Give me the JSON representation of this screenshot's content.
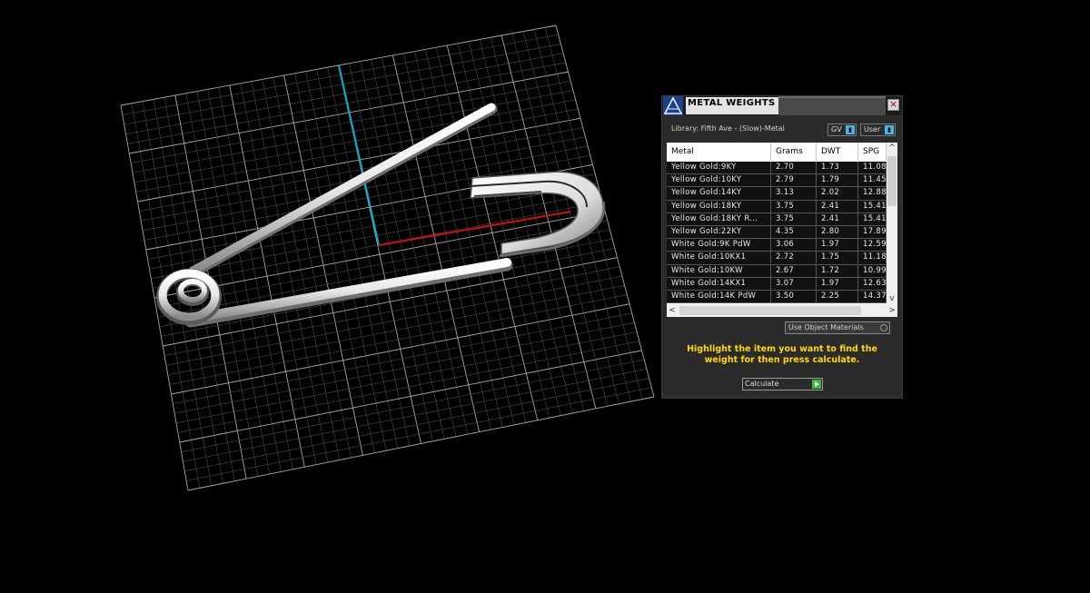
{
  "panel": {
    "title": "METAL WEIGHTS",
    "close_glyph": "×",
    "library_label": "Library: Fifth Ave - (Slow)-Metal",
    "mode_buttons": [
      {
        "label": "GV",
        "icon": "toggle-arrow-icon"
      },
      {
        "label": "User",
        "icon": "toggle-arrow-icon"
      }
    ],
    "table": {
      "columns": [
        "Metal",
        "Grams",
        "DWT",
        "SPG"
      ],
      "rows": [
        [
          "Yellow Gold:9KY",
          "2.70",
          "1.73",
          "11.08"
        ],
        [
          "Yellow Gold:10KY",
          "2.79",
          "1.79",
          "11.45"
        ],
        [
          "Yellow Gold:14KY",
          "3.13",
          "2.02",
          "12.88"
        ],
        [
          "Yellow Gold:18KY",
          "3.75",
          "2.41",
          "15.41"
        ],
        [
          "Yellow Gold:18KY R...",
          "3.75",
          "2.41",
          "15.41"
        ],
        [
          "Yellow Gold:22KY",
          "4.35",
          "2.80",
          "17.89"
        ],
        [
          "White Gold:9K PdW",
          "3.06",
          "1.97",
          "12.59"
        ],
        [
          "White Gold:10KX1",
          "2.72",
          "1.75",
          "11.18"
        ],
        [
          "White Gold:10KW",
          "2.67",
          "1.72",
          "10.99"
        ],
        [
          "White Gold:14KX1",
          "3.07",
          "1.97",
          "12.63"
        ],
        [
          "White Gold:14K PdW",
          "3.50",
          "2.25",
          "14.37"
        ]
      ]
    },
    "use_object_materials_label": "Use Object Materials",
    "instruction": "Highlight the item you want to find the weight for then press calculate.",
    "calculate_label": "Calculate"
  },
  "colors": {
    "background": "#000000",
    "grid": "#bfbfbf",
    "axis_y": "#00b0c8",
    "axis_x": "#d01010",
    "instruction_text": "#ffd900",
    "mode_arrow": "#4db6e0",
    "calculate_go": "#3ab83a"
  }
}
